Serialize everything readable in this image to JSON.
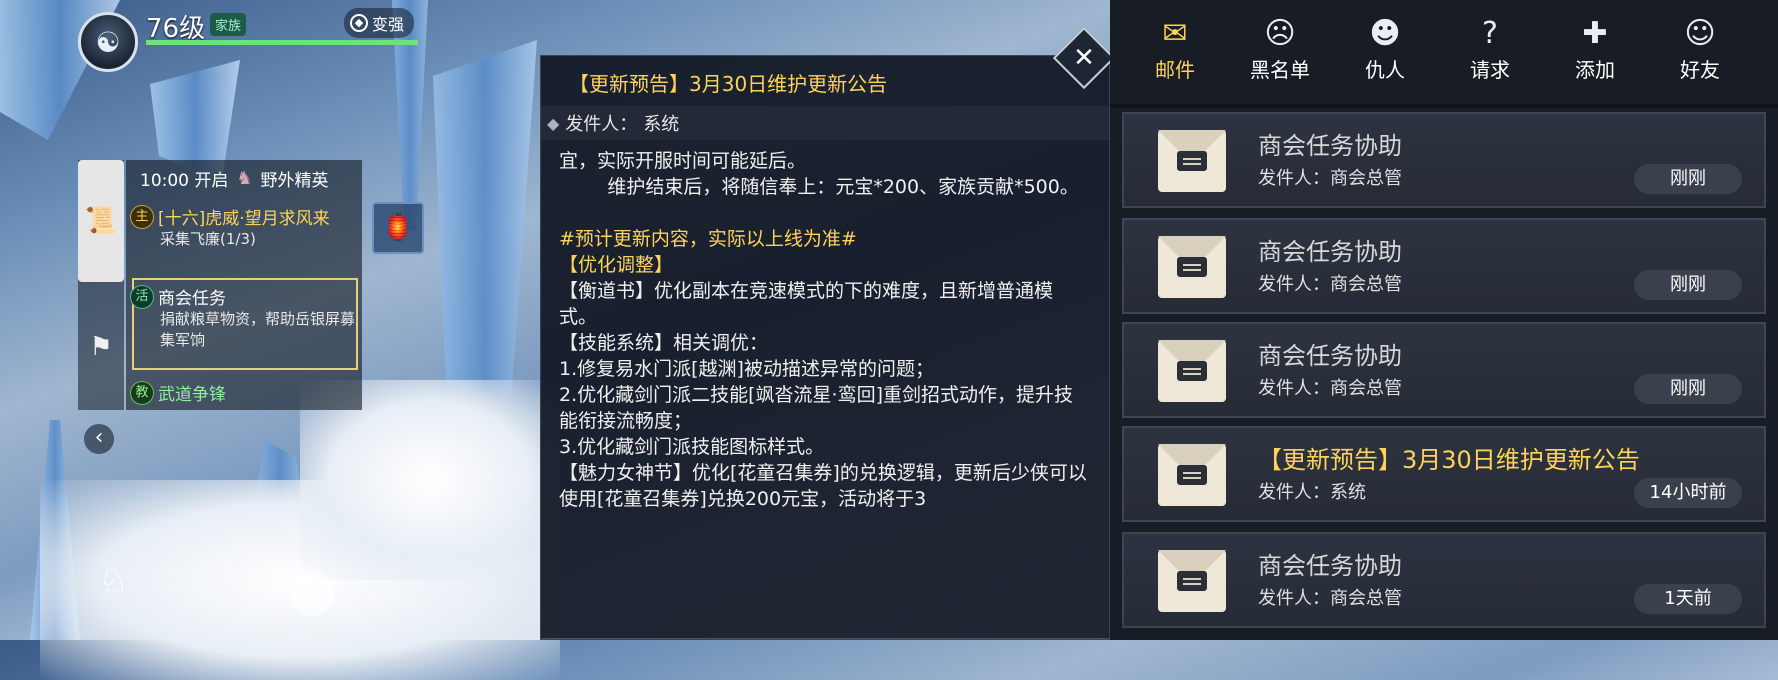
{
  "player": {
    "avatar_icon": "sect-emblem-icon",
    "level": "76级",
    "clan_badge": "家族",
    "strengthen_label": "变强",
    "strengthen_icon": "power-up-icon",
    "xp_progress": 1.0
  },
  "quest_tracker": {
    "tabs": [
      {
        "icon": "scroll-icon",
        "active": true
      },
      {
        "icon": "flag-icon",
        "active": false
      }
    ],
    "event_time": "10:00 开启",
    "event_name": "野外精英",
    "quests": [
      {
        "tag": "主",
        "title": "[十六]虎威·望月求风来",
        "sub": "采集飞廉(1/3)"
      },
      {
        "tag": "活",
        "title": "商会任务",
        "sub": "捐献粮草物资，帮助岳银屏募集军饷",
        "selected": true
      },
      {
        "tag": "教",
        "title": "武道争锋"
      }
    ],
    "item_icon": "lantern-item-icon"
  },
  "announcement": {
    "title": "【更新预告】3月30日维护更新公告",
    "sender_label": "发件人：",
    "sender": "系统",
    "body": [
      {
        "text": "宜，实际开服时间可能延后。",
        "hl": false
      },
      {
        "text": "        维护结束后，将随信奉上：元宝*200、家族贡献*500。",
        "hl": false
      },
      {
        "text": " ",
        "hl": false
      },
      {
        "text": "#预计更新内容，实际以上线为准#",
        "hl": true
      },
      {
        "text": "【优化调整】",
        "hl": true
      },
      {
        "text": "【衡道书】优化副本在竞速模式的下的难度，且新增普通模式。",
        "hl": false
      },
      {
        "text": "【技能系统】相关调优：",
        "hl": false
      },
      {
        "text": "1.修复易水门派[越渊]被动描述异常的问题；",
        "hl": false
      },
      {
        "text": "2.优化藏剑门派二技能[飒沓流星·鸾回]重剑招式动作，提升技能衔接流畅度；",
        "hl": false
      },
      {
        "text": "3.优化藏剑门派技能图标样式。",
        "hl": false
      },
      {
        "text": "【魅力女神节】优化[花童召集券]的兑换逻辑，更新后少侠可以使用[花童召集券]兑换200元宝，活动将于3",
        "hl": false
      }
    ],
    "close_label": "✕"
  },
  "social": {
    "tabs": [
      {
        "label": "邮件",
        "icon": "mail-icon",
        "active": true
      },
      {
        "label": "黑名单",
        "icon": "blacklist-icon",
        "active": false
      },
      {
        "label": "仇人",
        "icon": "enemy-icon",
        "active": false
      },
      {
        "label": "请求",
        "icon": "request-icon",
        "active": false
      },
      {
        "label": "添加",
        "icon": "add-friend-icon",
        "active": false
      },
      {
        "label": "好友",
        "icon": "friend-icon",
        "active": false
      }
    ],
    "mails": [
      {
        "subject": "商会任务协助",
        "from": "发件人：商会总管",
        "time": "刚刚",
        "highlight": false
      },
      {
        "subject": "商会任务协助",
        "from": "发件人：商会总管",
        "time": "刚刚",
        "highlight": false
      },
      {
        "subject": "商会任务协助",
        "from": "发件人：商会总管",
        "time": "刚刚",
        "highlight": false
      },
      {
        "subject": "【更新预告】3月30日维护更新公告",
        "from": "发件人：系统",
        "time": "14小时前",
        "highlight": true
      },
      {
        "subject": "商会任务协助",
        "from": "发件人：商会总管",
        "time": "1天前",
        "highlight": false
      }
    ]
  },
  "colors": {
    "gold": "#ffd35a",
    "panel": "#171c25",
    "xp": "#6ee27a"
  }
}
